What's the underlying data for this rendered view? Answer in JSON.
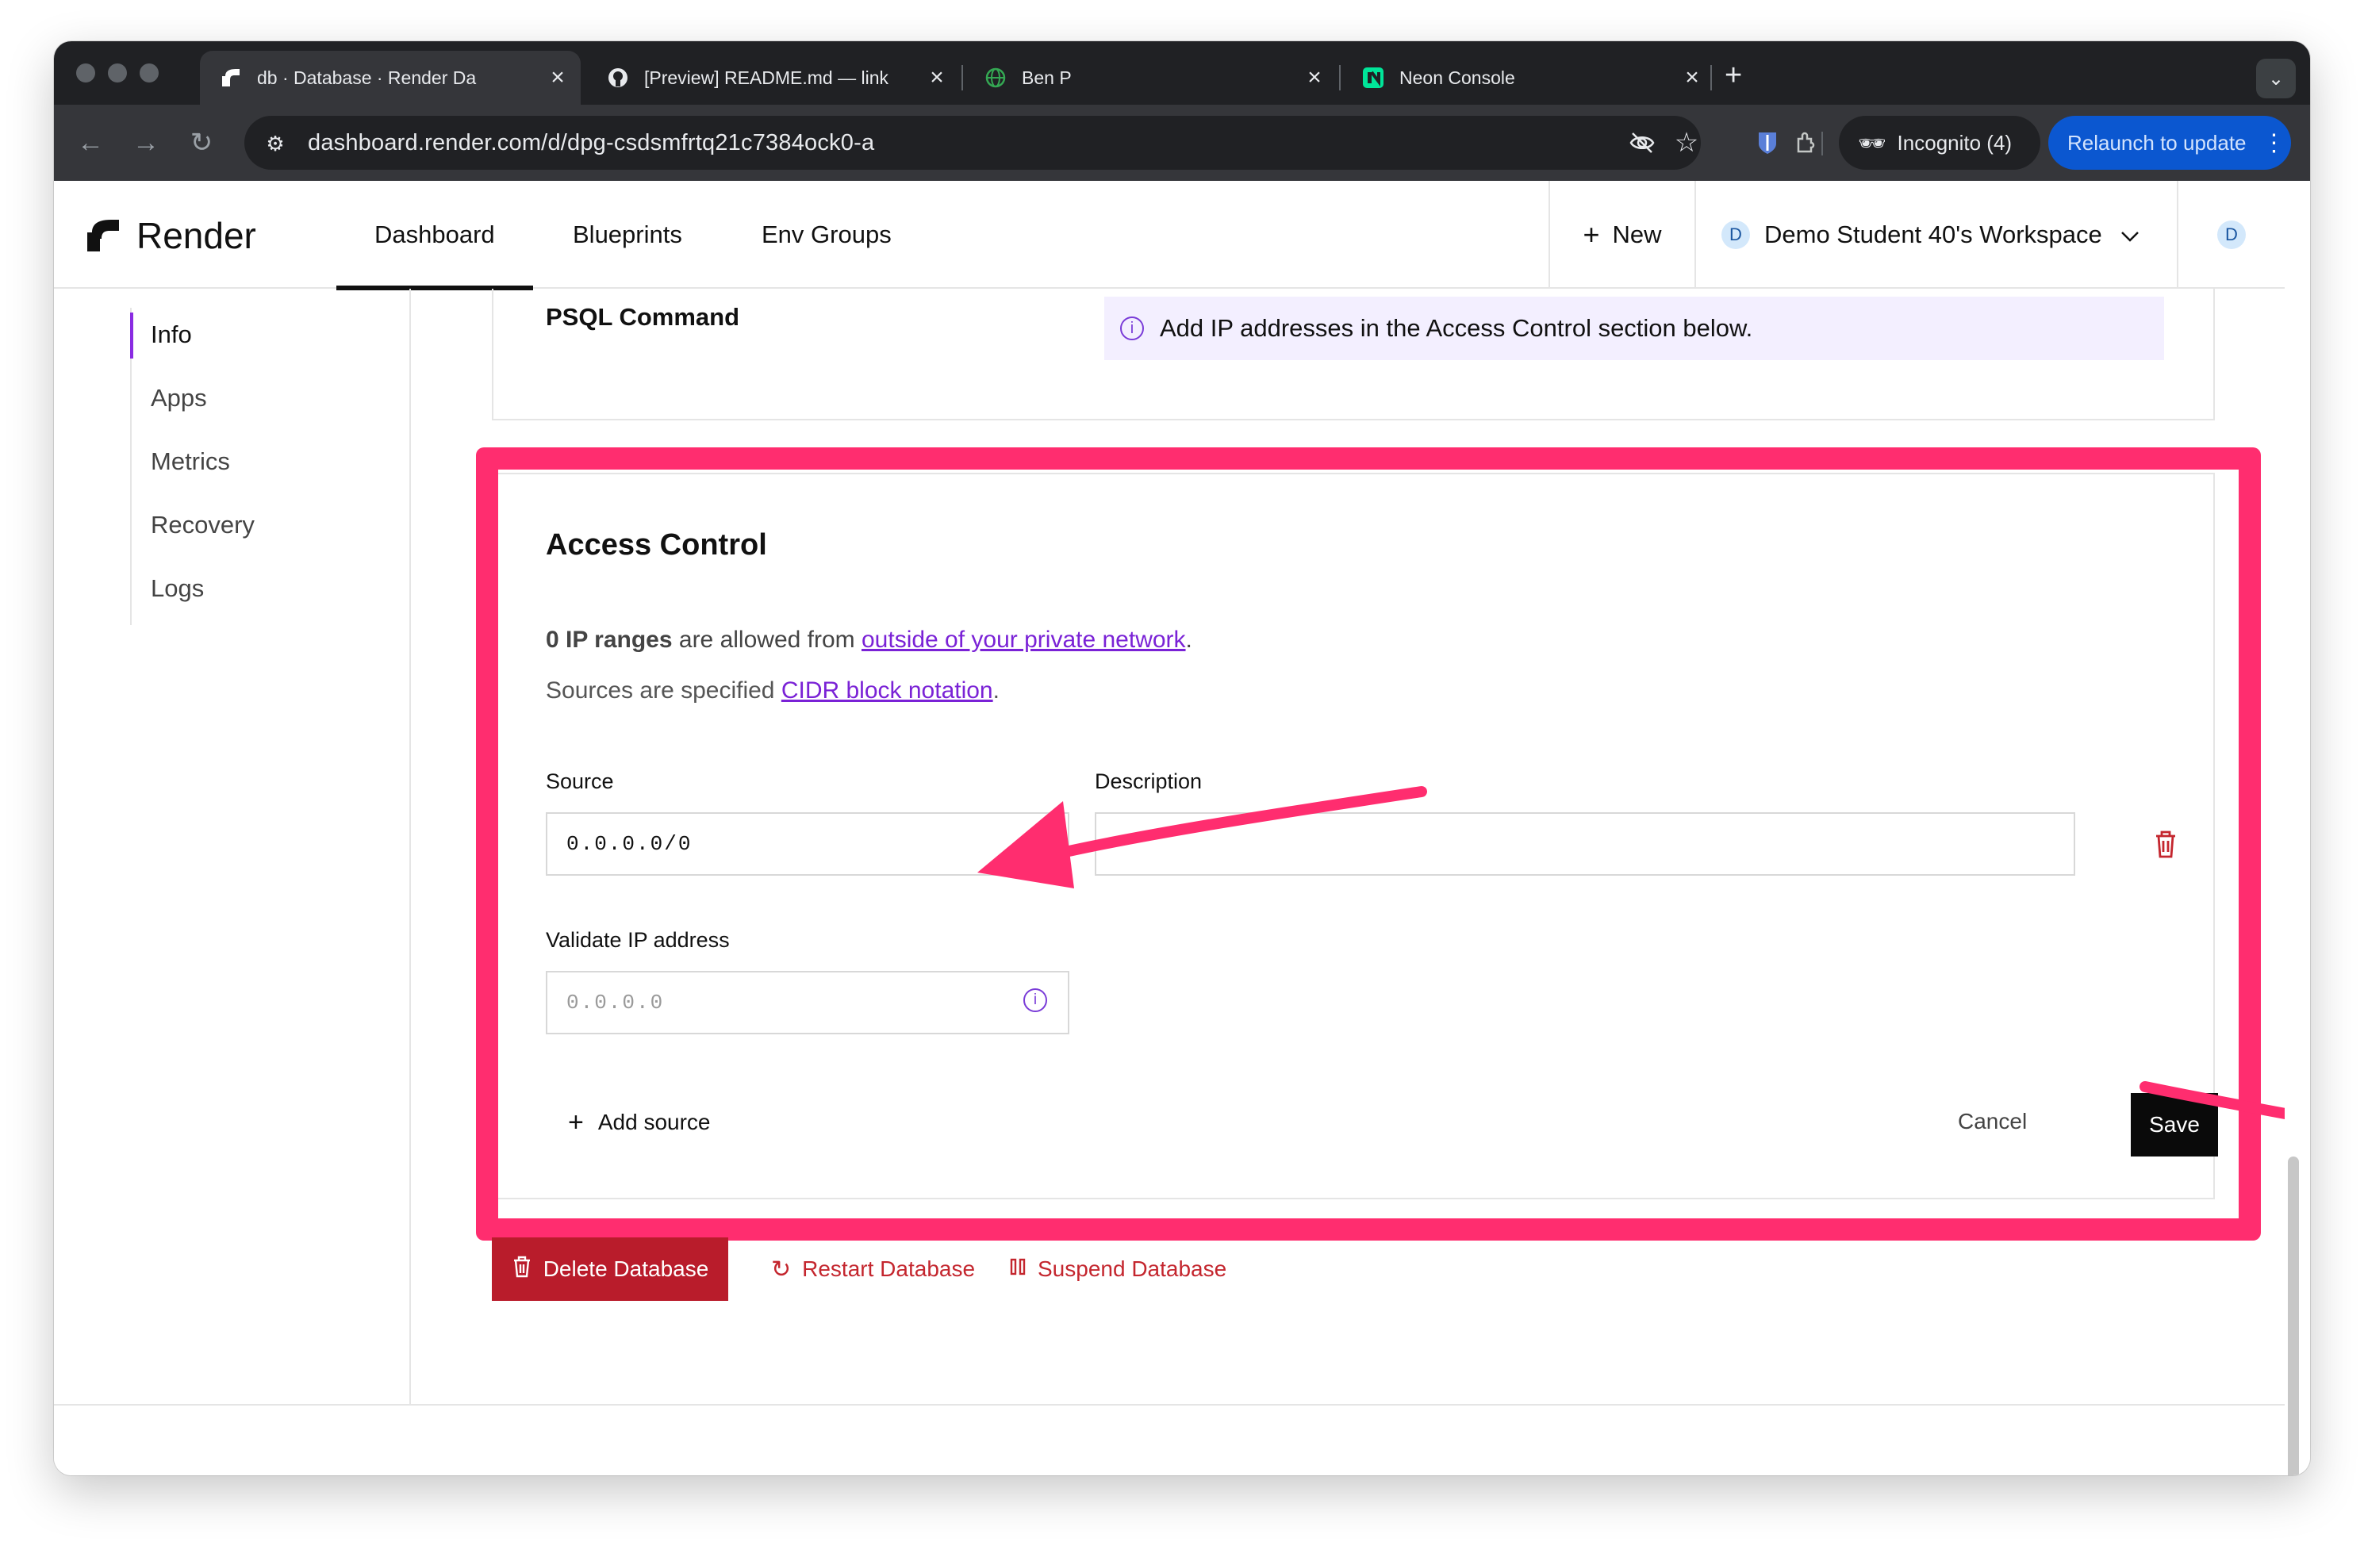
{
  "browser": {
    "tabs": [
      {
        "title": "db  ·  Database  ·  Render Da",
        "active": true,
        "icon": "render-logo-icon"
      },
      {
        "title": "[Preview] README.md — link",
        "active": false,
        "icon": "github-icon"
      },
      {
        "title": "Ben P",
        "active": false,
        "icon": "globe-icon"
      },
      {
        "title": "Neon Console",
        "active": false,
        "icon": "neon-icon"
      }
    ],
    "url": "dashboard.render.com/d/dpg-csdsmfrtq21c7384ock0-a",
    "incognito_label": "Incognito (4)",
    "relaunch_label": "Relaunch to update"
  },
  "header": {
    "brand": "Render",
    "nav": [
      "Dashboard",
      "Blueprints",
      "Env Groups"
    ],
    "new_label": "New",
    "workspace_initial": "D",
    "workspace_name": "Demo Student 40's Workspace",
    "user_initial": "D"
  },
  "sidebar": {
    "items": [
      "Info",
      "Apps",
      "Metrics",
      "Recovery",
      "Logs"
    ],
    "active": "Info"
  },
  "psql": {
    "label": "PSQL Command",
    "notice": "Add IP addresses in the Access Control section below."
  },
  "access_control": {
    "title": "Access Control",
    "count_text": "0 IP ranges",
    "allowed_text": " are allowed from ",
    "allowed_link": "outside of your private network",
    "period": ".",
    "sources_text": "Sources are specified ",
    "sources_link": "CIDR block notation",
    "source_label": "Source",
    "source_value": "0.0.0.0/0",
    "description_label": "Description",
    "description_value": "",
    "validate_label": "Validate IP address",
    "validate_placeholder": "0.0.0.0",
    "add_source_label": "Add source",
    "cancel_label": "Cancel",
    "save_label": "Save"
  },
  "danger_actions": {
    "delete_label": "Delete Database",
    "restart_label": "Restart Database",
    "suspend_label": "Suspend Database"
  },
  "colors": {
    "annotation": "#ff2d6f",
    "link": "#7a22d6",
    "danger": "#b91c2b",
    "primary": "#0a0a0a"
  }
}
